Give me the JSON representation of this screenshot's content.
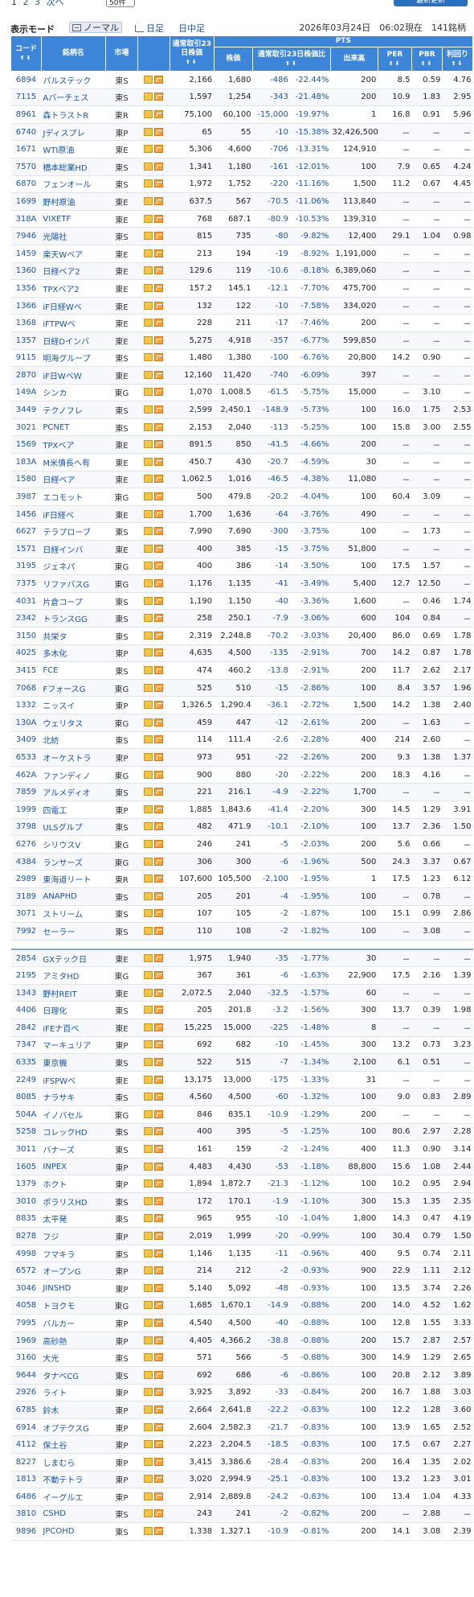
{
  "pager": {
    "pages": [
      "1",
      "2",
      "3",
      "次へ"
    ],
    "per_page": "50件"
  },
  "refresh_label": "最新更新",
  "mode": {
    "label": "表示モード",
    "normal": "ノーマル",
    "daily": "日足",
    "intraday": "日中足"
  },
  "status": "2026年03月24日　06:02現在　141銘柄",
  "headers": {
    "code": "コード",
    "name": "銘柄名",
    "market": "市場",
    "avg23": "通常取引23日株価",
    "pts": "PTS",
    "price": "株価",
    "ratio": "通常取引23日株価比",
    "volume": "出来高",
    "per": "PER",
    "pbr": "PBR",
    "yield": "利回り",
    "sort": "⬆⬇"
  },
  "rows": [
    [
      "6894",
      "パルステック",
      "東S",
      "2,166",
      "1,680",
      "-486",
      "-22.44%",
      "200",
      "8.5",
      "0.59",
      "4.76"
    ],
    [
      "7115",
      "Aバーチェス",
      "東S",
      "1,597",
      "1,254",
      "-343",
      "-21.48%",
      "200",
      "10.9",
      "1.83",
      "2.95"
    ],
    [
      "8961",
      "森トラストR",
      "東R",
      "75,100",
      "60,100",
      "-15,000",
      "-19.97%",
      "1",
      "16.8",
      "0.91",
      "5.96"
    ],
    [
      "6740",
      "Jディスプレ",
      "東P",
      "65",
      "55",
      "-10",
      "-15.38%",
      "32,426,500",
      "－",
      "－",
      "－"
    ],
    [
      "1671",
      "WTI原油",
      "東E",
      "5,306",
      "4,600",
      "-706",
      "-13.31%",
      "124,910",
      "－",
      "－",
      "－"
    ],
    [
      "7570",
      "橋本総業HD",
      "東S",
      "1,341",
      "1,180",
      "-161",
      "-12.01%",
      "100",
      "7.9",
      "0.65",
      "4.24"
    ],
    [
      "6870",
      "フェンオール",
      "東S",
      "1,972",
      "1,752",
      "-220",
      "-11.16%",
      "1,500",
      "11.2",
      "0.67",
      "4.45"
    ],
    [
      "1699",
      "野村原油",
      "東E",
      "637.5",
      "567",
      "-70.5",
      "-11.06%",
      "113,840",
      "－",
      "－",
      "－"
    ],
    [
      "318A",
      "VIXETF",
      "東E",
      "768",
      "687.1",
      "-80.9",
      "-10.53%",
      "139,310",
      "－",
      "－",
      "－"
    ],
    [
      "7946",
      "光陽社",
      "東S",
      "815",
      "735",
      "-80",
      "-9.82%",
      "12,400",
      "29.1",
      "1.04",
      "0.98"
    ],
    [
      "1459",
      "楽天Wベア",
      "東E",
      "213",
      "194",
      "-19",
      "-8.92%",
      "1,191,000",
      "－",
      "－",
      "－"
    ],
    [
      "1360",
      "日経ベア2",
      "東E",
      "129.6",
      "119",
      "-10.6",
      "-8.18%",
      "6,389,060",
      "－",
      "－",
      "－"
    ],
    [
      "1356",
      "TPXベア2",
      "東E",
      "157.2",
      "145.1",
      "-12.1",
      "-7.70%",
      "475,700",
      "－",
      "－",
      "－"
    ],
    [
      "1366",
      "iF日経Wベ",
      "東E",
      "132",
      "122",
      "-10",
      "-7.58%",
      "334,020",
      "－",
      "－",
      "－"
    ],
    [
      "1368",
      "iFTPWベ",
      "東E",
      "228",
      "211",
      "-17",
      "-7.46%",
      "200",
      "－",
      "－",
      "－"
    ],
    [
      "1357",
      "日経Dインバ",
      "東E",
      "5,275",
      "4,918",
      "-357",
      "-6.77%",
      "599,850",
      "－",
      "－",
      "－"
    ],
    [
      "9115",
      "明海グループ",
      "東S",
      "1,480",
      "1,380",
      "-100",
      "-6.76%",
      "20,800",
      "14.2",
      "0.90",
      "－"
    ],
    [
      "2870",
      "iF日WベＷ",
      "東E",
      "12,160",
      "11,420",
      "-740",
      "-6.09%",
      "397",
      "－",
      "－",
      "－"
    ],
    [
      "149A",
      "シンカ",
      "東G",
      "1,070",
      "1,008.5",
      "-61.5",
      "-5.75%",
      "15,000",
      "－",
      "3.10",
      "－"
    ],
    [
      "3449",
      "テクノフレ",
      "東S",
      "2,599",
      "2,450.1",
      "-148.9",
      "-5.73%",
      "100",
      "16.0",
      "1.75",
      "2.53"
    ],
    [
      "3021",
      "PCNET",
      "東S",
      "2,153",
      "2,040",
      "-113",
      "-5.25%",
      "100",
      "15.8",
      "3.00",
      "2.55"
    ],
    [
      "1569",
      "TPXベア",
      "東E",
      "891.5",
      "850",
      "-41.5",
      "-4.66%",
      "200",
      "－",
      "－",
      "－"
    ],
    [
      "183A",
      "M米債長へ有",
      "東E",
      "450.7",
      "430",
      "-20.7",
      "-4.59%",
      "30",
      "－",
      "－",
      "－"
    ],
    [
      "1580",
      "日経ベア",
      "東E",
      "1,062.5",
      "1,016",
      "-46.5",
      "-4.38%",
      "11,080",
      "－",
      "－",
      "－"
    ],
    [
      "3987",
      "エコモット",
      "東G",
      "500",
      "479.8",
      "-20.2",
      "-4.04%",
      "100",
      "60.4",
      "3.09",
      "－"
    ],
    [
      "1456",
      "iF日経ベ",
      "東E",
      "1,700",
      "1,636",
      "-64",
      "-3.76%",
      "490",
      "－",
      "－",
      "－"
    ],
    [
      "6627",
      "テラプローブ",
      "東S",
      "7,990",
      "7,690",
      "-300",
      "-3.75%",
      "100",
      "－",
      "1.73",
      "－"
    ],
    [
      "1571",
      "日経インバ",
      "東E",
      "400",
      "385",
      "-15",
      "-3.75%",
      "51,800",
      "－",
      "－",
      "－"
    ],
    [
      "3195",
      "ジェネパ",
      "東G",
      "400",
      "386",
      "-14",
      "-3.50%",
      "100",
      "17.5",
      "1.57",
      "－"
    ],
    [
      "7375",
      "リファバスG",
      "東G",
      "1,176",
      "1,135",
      "-41",
      "-3.49%",
      "5,400",
      "12.7",
      "12.50",
      "－"
    ],
    [
      "4031",
      "片倉コープ",
      "東S",
      "1,190",
      "1,150",
      "-40",
      "-3.36%",
      "1,600",
      "－",
      "0.46",
      "1.74"
    ],
    [
      "2342",
      "トランスGG",
      "東S",
      "258",
      "250.1",
      "-7.9",
      "-3.06%",
      "600",
      "104",
      "0.84",
      "－"
    ],
    [
      "3150",
      "共栄タ",
      "東S",
      "2,319",
      "2,248.8",
      "-70.2",
      "-3.03%",
      "20,400",
      "86.0",
      "0.69",
      "1.78"
    ],
    [
      "4025",
      "多木化",
      "東P",
      "4,635",
      "4,500",
      "-135",
      "-2.91%",
      "700",
      "14.2",
      "0.87",
      "1.78"
    ],
    [
      "3415",
      "FCE",
      "東S",
      "474",
      "460.2",
      "-13.8",
      "-2.91%",
      "200",
      "11.7",
      "2.62",
      "2.17"
    ],
    [
      "7068",
      "FフォースG",
      "東G",
      "525",
      "510",
      "-15",
      "-2.86%",
      "100",
      "8.4",
      "3.57",
      "1.96"
    ],
    [
      "1332",
      "ニッスイ",
      "東P",
      "1,326.5",
      "1,290.4",
      "-36.1",
      "-2.72%",
      "1,500",
      "14.2",
      "1.38",
      "2.40"
    ],
    [
      "130A",
      "ウェリタス",
      "東G",
      "459",
      "447",
      "-12",
      "-2.61%",
      "200",
      "－",
      "1.63",
      "－"
    ],
    [
      "3409",
      "北紡",
      "東S",
      "114",
      "111.4",
      "-2.6",
      "-2.28%",
      "400",
      "214",
      "2.60",
      "－"
    ],
    [
      "6533",
      "オーケストラ",
      "東P",
      "973",
      "951",
      "-22",
      "-2.26%",
      "200",
      "9.3",
      "1.38",
      "1.37"
    ],
    [
      "462A",
      "ファンディノ",
      "東G",
      "900",
      "880",
      "-20",
      "-2.22%",
      "200",
      "18.3",
      "4.16",
      "－"
    ],
    [
      "7859",
      "アルメディオ",
      "東S",
      "221",
      "216.1",
      "-4.9",
      "-2.22%",
      "1,700",
      "－",
      "－",
      "－"
    ],
    [
      "1999",
      "四電工",
      "東P",
      "1,885",
      "1,843.6",
      "-41.4",
      "-2.20%",
      "300",
      "14.5",
      "1.29",
      "3.91"
    ],
    [
      "3798",
      "ULSグルプ",
      "東S",
      "482",
      "471.9",
      "-10.1",
      "-2.10%",
      "100",
      "13.7",
      "2.36",
      "1.50"
    ],
    [
      "6276",
      "シリウスV",
      "東G",
      "246",
      "241",
      "-5",
      "-2.03%",
      "200",
      "5.6",
      "0.66",
      "－"
    ],
    [
      "4384",
      "ランサーズ",
      "東G",
      "306",
      "300",
      "-6",
      "-1.96%",
      "500",
      "24.3",
      "3.37",
      "0.67"
    ],
    [
      "2989",
      "東海道リート",
      "東R",
      "107,600",
      "105,500",
      "-2,100",
      "-1.95%",
      "1",
      "17.5",
      "1.23",
      "6.12"
    ],
    [
      "3189",
      "ANAPHD",
      "東S",
      "205",
      "201",
      "-4",
      "-1.95%",
      "100",
      "－",
      "0.78",
      "－"
    ],
    [
      "3071",
      "ストリーム",
      "東S",
      "107",
      "105",
      "-2",
      "-1.87%",
      "100",
      "15.1",
      "0.99",
      "2.86"
    ],
    [
      "7992",
      "セーラー",
      "東S",
      "110",
      "108",
      "-2",
      "-1.82%",
      "100",
      "－",
      "3.08",
      "－"
    ],
    [
      "SEP"
    ],
    [
      "2854",
      "GXテック日",
      "東E",
      "1,975",
      "1,940",
      "-35",
      "-1.77%",
      "30",
      "－",
      "－",
      "－"
    ],
    [
      "2195",
      "アミタHD",
      "東G",
      "367",
      "361",
      "-6",
      "-1.63%",
      "22,900",
      "17.5",
      "2.16",
      "1.39"
    ],
    [
      "1343",
      "野村REIT",
      "東E",
      "2,072.5",
      "2,040",
      "-32.5",
      "-1.57%",
      "60",
      "－",
      "－",
      "－"
    ],
    [
      "4406",
      "日理化",
      "東S",
      "205",
      "201.8",
      "-3.2",
      "-1.56%",
      "300",
      "13.7",
      "0.39",
      "1.98"
    ],
    [
      "2842",
      "iFEナ百べ",
      "東E",
      "15,225",
      "15,000",
      "-225",
      "-1.48%",
      "8",
      "－",
      "－",
      "－"
    ],
    [
      "7347",
      "マーキュリア",
      "東P",
      "692",
      "682",
      "-10",
      "-1.45%",
      "300",
      "13.2",
      "0.73",
      "3.23"
    ],
    [
      "6335",
      "東京機",
      "東S",
      "522",
      "515",
      "-7",
      "-1.34%",
      "2,100",
      "6.1",
      "0.51",
      "－"
    ],
    [
      "2249",
      "iFSPWベ",
      "東E",
      "13,175",
      "13,000",
      "-175",
      "-1.33%",
      "31",
      "－",
      "－",
      "－"
    ],
    [
      "8085",
      "ナラサキ",
      "東S",
      "4,560",
      "4,500",
      "-60",
      "-1.32%",
      "100",
      "9.0",
      "0.83",
      "2.89"
    ],
    [
      "504A",
      "イノバセル",
      "東G",
      "846",
      "835.1",
      "-10.9",
      "-1.29%",
      "200",
      "－",
      "－",
      "－"
    ],
    [
      "5258",
      "コレックHD",
      "東S",
      "400",
      "395",
      "-5",
      "-1.25%",
      "100",
      "80.6",
      "2.97",
      "2.28"
    ],
    [
      "3011",
      "バナーズ",
      "東S",
      "161",
      "159",
      "-2",
      "-1.24%",
      "400",
      "11.3",
      "0.90",
      "3.14"
    ],
    [
      "1605",
      "INPEX",
      "東P",
      "4,483",
      "4,430",
      "-53",
      "-1.18%",
      "88,800",
      "15.6",
      "1.08",
      "2.44"
    ],
    [
      "1379",
      "ホクト",
      "東P",
      "1,894",
      "1,872.7",
      "-21.3",
      "-1.12%",
      "100",
      "10.2",
      "0.95",
      "2.94"
    ],
    [
      "3010",
      "ポラリスHD",
      "東S",
      "172",
      "170.1",
      "-1.9",
      "-1.10%",
      "300",
      "15.3",
      "1.35",
      "2.35"
    ],
    [
      "8835",
      "太平発",
      "東S",
      "965",
      "955",
      "-10",
      "-1.04%",
      "1,800",
      "14.3",
      "0.47",
      "4.19"
    ],
    [
      "8278",
      "フジ",
      "東P",
      "2,019",
      "1,999",
      "-20",
      "-0.99%",
      "100",
      "30.4",
      "0.79",
      "1.50"
    ],
    [
      "4998",
      "フマキラ",
      "東S",
      "1,146",
      "1,135",
      "-11",
      "-0.96%",
      "400",
      "9.5",
      "0.74",
      "2.11"
    ],
    [
      "6572",
      "オープンG",
      "東P",
      "214",
      "212",
      "-2",
      "-0.93%",
      "900",
      "22.9",
      "1.11",
      "2.12"
    ],
    [
      "3046",
      "JINSHD",
      "東P",
      "5,140",
      "5,092",
      "-48",
      "-0.93%",
      "100",
      "13.5",
      "3.74",
      "2.26"
    ],
    [
      "4058",
      "トヨクモ",
      "東G",
      "1,685",
      "1,670.1",
      "-14.9",
      "-0.88%",
      "200",
      "14.0",
      "4.52",
      "1.62"
    ],
    [
      "7995",
      "バルカー",
      "東P",
      "4,540",
      "4,500",
      "-40",
      "-0.88%",
      "100",
      "12.8",
      "1.55",
      "3.33"
    ],
    [
      "1969",
      "高砂熱",
      "東P",
      "4,405",
      "4,366.2",
      "-38.8",
      "-0.88%",
      "200",
      "15.7",
      "2.87",
      "2.57"
    ],
    [
      "3160",
      "大光",
      "東S",
      "571",
      "566",
      "-5",
      "-0.88%",
      "300",
      "14.9",
      "1.29",
      "2.65"
    ],
    [
      "9644",
      "タナベCG",
      "東S",
      "692",
      "686",
      "-6",
      "-0.86%",
      "100",
      "20.8",
      "2.12",
      "3.89"
    ],
    [
      "2926",
      "ライト",
      "東P",
      "3,925",
      "3,892",
      "-33",
      "-0.84%",
      "200",
      "16.7",
      "1.88",
      "3.03"
    ],
    [
      "6785",
      "鈴木",
      "東P",
      "2,664",
      "2,641.8",
      "-22.2",
      "-0.83%",
      "100",
      "12.2",
      "1.28",
      "3.60"
    ],
    [
      "6914",
      "オプテクスG",
      "東P",
      "2,604",
      "2,582.3",
      "-21.7",
      "-0.83%",
      "100",
      "13.9",
      "1.65",
      "2.52"
    ],
    [
      "4112",
      "保土谷",
      "東P",
      "2,223",
      "2,204.5",
      "-18.5",
      "-0.83%",
      "100",
      "17.5",
      "0.67",
      "2.27"
    ],
    [
      "8227",
      "しまむら",
      "東P",
      "3,415",
      "3,386.6",
      "-28.4",
      "-0.83%",
      "200",
      "16.4",
      "1.35",
      "2.02"
    ],
    [
      "1813",
      "不動テトラ",
      "東P",
      "3,020",
      "2,994.9",
      "-25.1",
      "-0.83%",
      "100",
      "13.2",
      "1.23",
      "3.01"
    ],
    [
      "6486",
      "イーグルエ",
      "東P",
      "2,914",
      "2,889.8",
      "-24.2",
      "-0.83%",
      "100",
      "13.4",
      "1.04",
      "4.33"
    ],
    [
      "3810",
      "CSHD",
      "東S",
      "243",
      "241",
      "-2",
      "-0.82%",
      "200",
      "－",
      "2.88",
      "－"
    ],
    [
      "9896",
      "JPCOHD",
      "東S",
      "1,338",
      "1,327.1",
      "-10.9",
      "-0.81%",
      "200",
      "14.1",
      "3.08",
      "2.39"
    ]
  ]
}
